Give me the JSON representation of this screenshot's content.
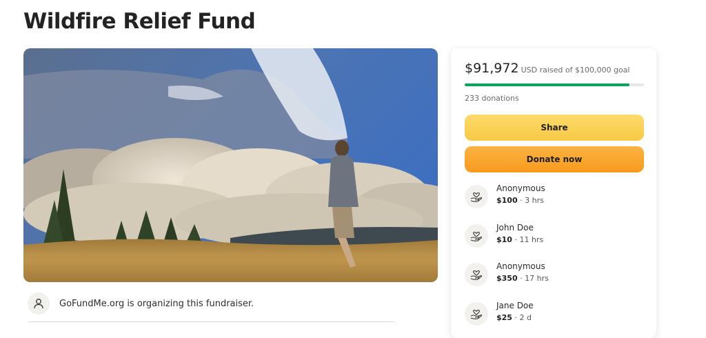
{
  "page": {
    "title": "Wildfire Relief Fund"
  },
  "hero_image": {
    "description_icon": "wildfire-photo"
  },
  "organizer": {
    "text": "GoFundMe.org is organizing this fundraiser.",
    "icon": "user-icon"
  },
  "campaign": {
    "raised_amount": "$91,972",
    "raised_caption": "USD raised of $100,000 goal",
    "progress_fraction": 0.91972,
    "donations_text": "233 donations",
    "progress_color": "#02a95c"
  },
  "actions": {
    "share_label": "Share",
    "donate_label": "Donate now"
  },
  "donors": [
    {
      "name": "Anonymous",
      "amount": "$100",
      "time": " · 3 hrs"
    },
    {
      "name": "John Doe",
      "amount": "$10",
      "time": " · 11 hrs"
    },
    {
      "name": "Anonymous",
      "amount": "$350",
      "time": " · 17 hrs"
    },
    {
      "name": "Jane Doe",
      "amount": "$25",
      "time": " · 2 d"
    }
  ]
}
